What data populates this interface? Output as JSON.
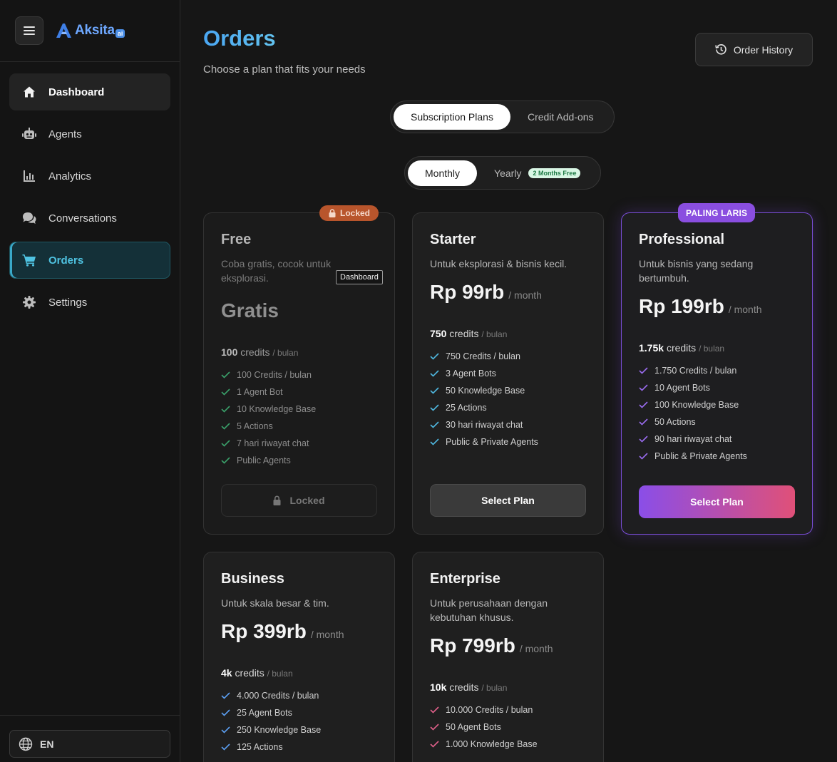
{
  "brand": {
    "name": "Aksita",
    "suffix": "ai"
  },
  "sidebar": {
    "items": [
      {
        "label": "Dashboard",
        "icon": "home-icon"
      },
      {
        "label": "Agents",
        "icon": "robot-icon"
      },
      {
        "label": "Analytics",
        "icon": "chart-icon"
      },
      {
        "label": "Conversations",
        "icon": "chat-icon"
      },
      {
        "label": "Orders",
        "icon": "cart-icon"
      },
      {
        "label": "Settings",
        "icon": "gear-icon"
      }
    ],
    "language": "EN"
  },
  "header": {
    "title": "Orders",
    "subtitle": "Choose a plan that fits your needs",
    "history_label": "Order History"
  },
  "tabs": {
    "subscription": "Subscription Plans",
    "addons": "Credit Add-ons"
  },
  "billing": {
    "monthly": "Monthly",
    "yearly": "Yearly",
    "yearly_badge": "2 Months Free"
  },
  "colors": {
    "accent": "#4fc3e2",
    "pro_accent": "#8a4ee0",
    "locked_badge": "#b8552c"
  },
  "plans": [
    {
      "name": "Free",
      "desc": "Coba gratis, cocok untuk eksplorasi.",
      "price": "Gratis",
      "per": "",
      "credits": "100",
      "credits_label": "credits",
      "credits_unit": "/ bulan",
      "features": [
        "100 Credits / bulan",
        "1 Agent Bot",
        "10 Knowledge Base",
        "5 Actions",
        "7 hari riwayat chat",
        "Public Agents"
      ],
      "button": "Locked",
      "badge": "Locked",
      "tooltip": "Dashboard"
    },
    {
      "name": "Starter",
      "desc": "Untuk eksplorasi & bisnis kecil.",
      "price": "Rp 99rb",
      "per": "/ month",
      "credits": "750",
      "credits_label": "credits",
      "credits_unit": "/ bulan",
      "features": [
        "750 Credits / bulan",
        "3 Agent Bots",
        "50 Knowledge Base",
        "25 Actions",
        "30 hari riwayat chat",
        "Public & Private Agents"
      ],
      "button": "Select Plan"
    },
    {
      "name": "Professional",
      "desc": "Untuk bisnis yang sedang bertumbuh.",
      "price": "Rp 199rb",
      "per": "/ month",
      "credits": "1.75k",
      "credits_label": "credits",
      "credits_unit": "/ bulan",
      "features": [
        "1.750 Credits / bulan",
        "10 Agent Bots",
        "100 Knowledge Base",
        "50 Actions",
        "90 hari riwayat chat",
        "Public & Private Agents"
      ],
      "button": "Select Plan",
      "badge": "PALING LARIS"
    },
    {
      "name": "Business",
      "desc": "Untuk skala besar & tim.",
      "price": "Rp 399rb",
      "per": "/ month",
      "credits": "4k",
      "credits_label": "credits",
      "credits_unit": "/ bulan",
      "features": [
        "4.000 Credits / bulan",
        "25 Agent Bots",
        "250 Knowledge Base",
        "125 Actions"
      ]
    },
    {
      "name": "Enterprise",
      "desc": "Untuk perusahaan dengan kebutuhan khusus.",
      "price": "Rp 799rb",
      "per": "/ month",
      "credits": "10k",
      "credits_label": "credits",
      "credits_unit": "/ bulan",
      "features": [
        "10.000 Credits / bulan",
        "50 Agent Bots",
        "1.000 Knowledge Base"
      ]
    }
  ]
}
